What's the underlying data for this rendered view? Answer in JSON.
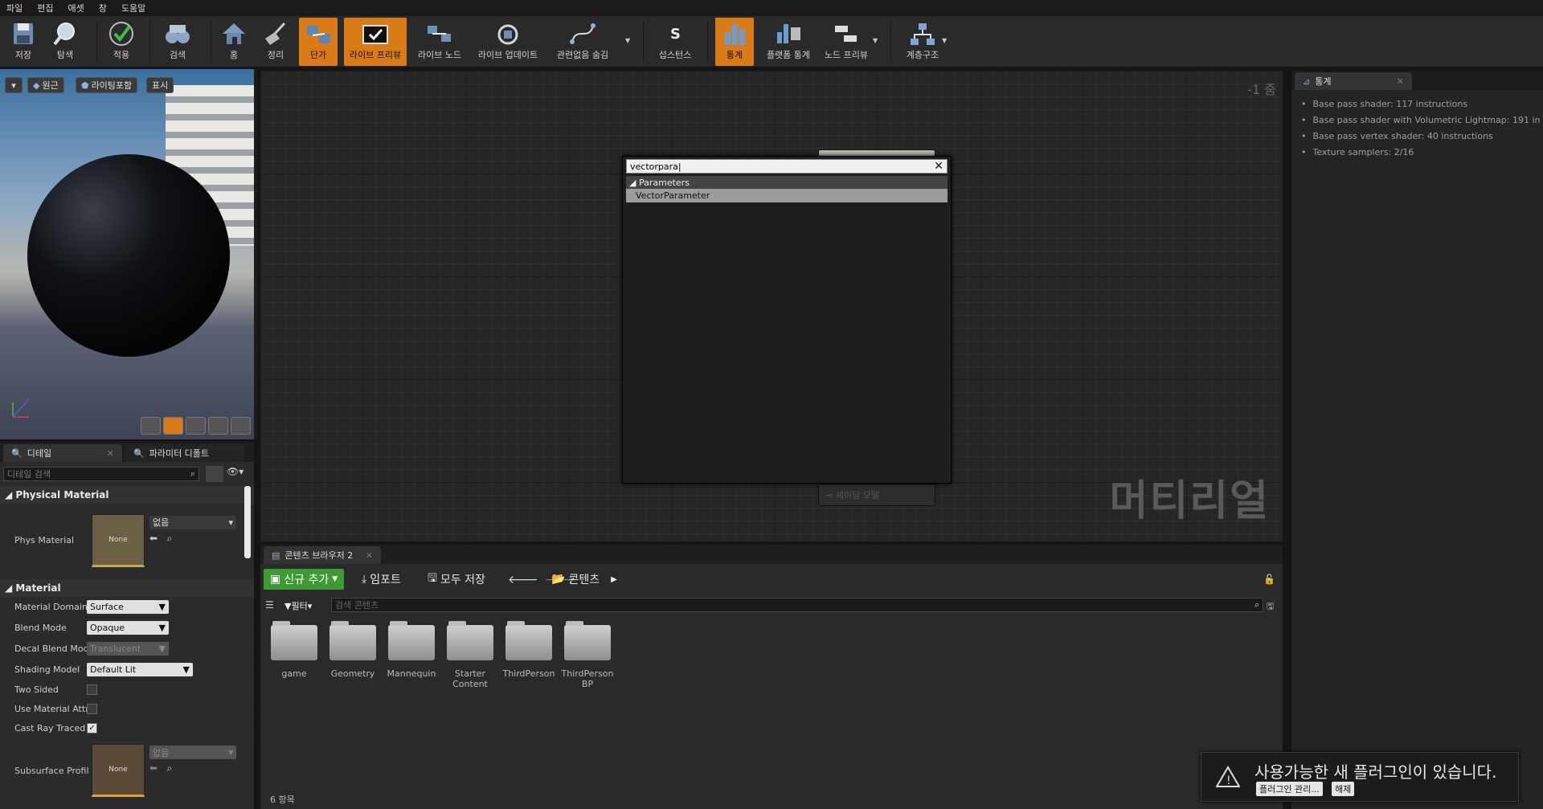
{
  "menu": [
    "파일",
    "편집",
    "애셋",
    "창",
    "도움말"
  ],
  "toolbar": {
    "items": [
      "저장",
      "탐색",
      "적용",
      "검색",
      "홈",
      "정리",
      "단가",
      "라이브 프리뷰",
      "라이브 노드",
      "라이브 업데이트",
      "관련없음 숨김",
      "섭스턴스",
      "통계",
      "플랫폼 통계",
      "노드 프리뷰",
      "계층구조"
    ],
    "active": [
      "단가",
      "라이브 프리뷰",
      "통계"
    ]
  },
  "viewport": {
    "btn_perspective": "원근",
    "btn_lit": "라이팅포함",
    "btn_show": "표시"
  },
  "details": {
    "tab_details": "디테일",
    "tab_params": "파라미터 디폴트",
    "search_placeholder": "디테일 검색",
    "cat_physical": "Physical Material",
    "phys_material_label": "Phys Material",
    "phys_thumb": "None",
    "phys_value": "없음",
    "cat_material": "Material",
    "material_domain_label": "Material Domain",
    "material_domain_value": "Surface",
    "blend_mode_label": "Blend Mode",
    "blend_mode_value": "Opaque",
    "decal_blend_label": "Decal Blend Mode",
    "decal_blend_value": "Translucent",
    "shading_model_label": "Shading Model",
    "shading_model_value": "Default Lit",
    "two_sided_label": "Two Sided",
    "use_attr_label": "Use Material Attri",
    "cast_ray_label": "Cast Ray Traced S",
    "subsurface_label": "Subsurface Profil",
    "subsurface_thumb": "None",
    "subsurface_value": "없음"
  },
  "graph": {
    "zoom": "-1 줌",
    "watermark": "머티리얼",
    "node_label": "셰이딩 모델",
    "popup": {
      "query": "vectorpara",
      "category": "Parameters",
      "item": "VectorParameter"
    }
  },
  "stats": {
    "tab": "통계",
    "lines": [
      "Base pass shader: 117 instructions",
      "Base pass shader with Volumetric Lightmap: 191 in",
      "Base pass vertex shader: 40 instructions",
      "Texture samplers: 2/16"
    ]
  },
  "content_browser": {
    "tab": "콘텐츠 브라우저 2",
    "add_new": "신규 추가",
    "import": "임포트",
    "save_all": "모두 저장",
    "path": "콘텐츠",
    "filter": "필터",
    "search_placeholder": "검색 콘텐츠",
    "folders": [
      "game",
      "Geometry",
      "Mannequin",
      "Starter Content",
      "ThirdPerson",
      "ThirdPerson BP"
    ],
    "count": "6 항목"
  },
  "notification": {
    "text": "사용가능한 새 플러그인이 있습니다.",
    "btn_manage": "플러그인 관리...",
    "btn_dismiss": "해제"
  },
  "colors": {
    "accent": "#d97b17",
    "add_new": "#3e9a33"
  }
}
